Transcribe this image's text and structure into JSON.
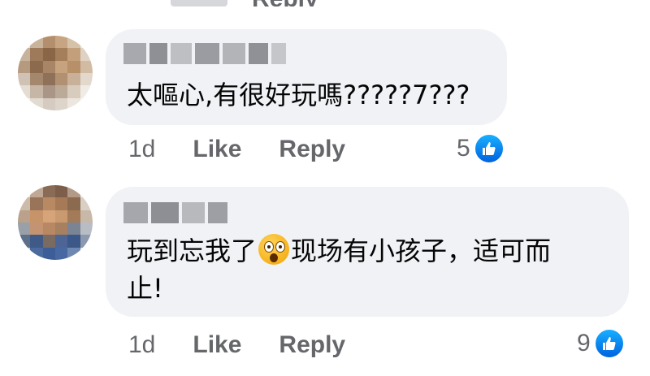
{
  "top_fragment": {
    "text": "Reply"
  },
  "comments": [
    {
      "author": "",
      "text": "太嘔心,有很好玩嗎?????7???",
      "time": "1d",
      "like_label": "Like",
      "reply_label": "Reply",
      "reaction_count": "5",
      "reaction_icon": "thumbs-up-icon"
    },
    {
      "author": "",
      "text_before_emoji": "玩到忘我了",
      "emoji_icon": "astonished-face-icon",
      "text_after_emoji": "现场有小孩子，适可而",
      "text_line2": "止!",
      "time": "1d",
      "like_label": "Like",
      "reply_label": "Reply",
      "reaction_count": "9",
      "reaction_icon": "thumbs-up-icon"
    }
  ],
  "colors": {
    "bubble": "#f0f2f5",
    "meta_text": "#65676b",
    "body_text": "#050505",
    "like_blue": "#0571ed"
  }
}
